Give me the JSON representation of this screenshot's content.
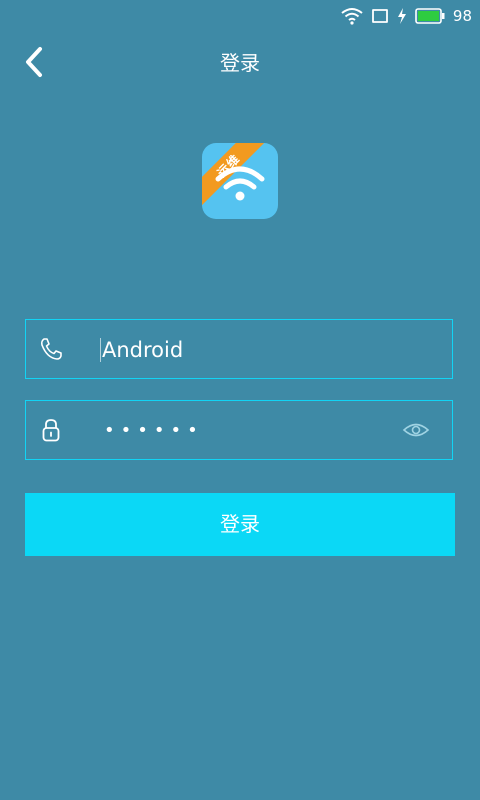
{
  "status_bar": {
    "battery_percent": "98",
    "icons": [
      "wifi-icon",
      "screen-rotation-icon",
      "charging-icon",
      "battery-icon"
    ],
    "battery_color": "#2ecc40"
  },
  "header": {
    "title": "登录",
    "back_icon": "chevron-left-icon"
  },
  "app_icon": {
    "badge_text": "运维",
    "icon": "wifi-icon",
    "background": "#55c3f0",
    "badge_color": "#f29a1f"
  },
  "form": {
    "phone": {
      "icon": "phone-icon",
      "value": "Android"
    },
    "password": {
      "icon": "lock-icon",
      "masked_value": "••••••",
      "toggle_icon": "eye-icon"
    },
    "submit_label": "登录"
  },
  "colors": {
    "background": "#3e8aa6",
    "field_border": "#12d4f5",
    "button": "#0bd8f6"
  }
}
